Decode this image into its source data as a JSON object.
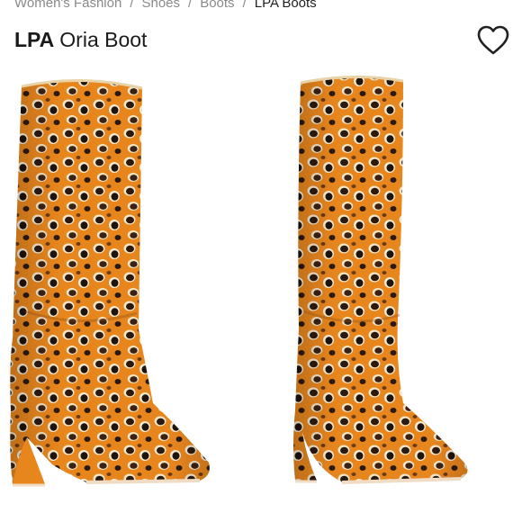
{
  "breadcrumb": {
    "items": [
      "Women's Fashion",
      "Shoes",
      "Boots"
    ],
    "current": "LPA Boots",
    "separator": "/"
  },
  "product": {
    "brand": "LPA",
    "name": "Oria Boot"
  },
  "icons": {
    "favorite": "heart-outline-icon"
  },
  "colors": {
    "boot_base": "#E8861E",
    "spot_dark": "#2A1A12",
    "spot_ring": "#F4E6C8",
    "sole": "#F0DCC4"
  }
}
